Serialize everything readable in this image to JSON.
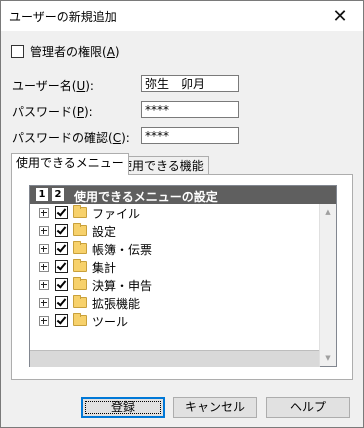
{
  "window": {
    "title": "ユーザーの新規追加",
    "close_glyph": "✕"
  },
  "admin_checkbox": {
    "label": "管理者の権限(",
    "accel": "A",
    "label_end": ")",
    "checked": false
  },
  "fields": {
    "username": {
      "label": "ユーザー名(",
      "accel": "U",
      "label_end": "):",
      "value": "弥生　卯月"
    },
    "password": {
      "label": "パスワード(",
      "accel": "P",
      "label_end": "):",
      "value": "****"
    },
    "password_confirm": {
      "label": "パスワードの確認(",
      "accel": "C",
      "label_end": "):",
      "value": "****"
    }
  },
  "tabs": {
    "menus": "使用できるメニュー",
    "features": "使用できる機能"
  },
  "tree": {
    "levels": [
      "1",
      "2"
    ],
    "header": "使用できるメニューの設定",
    "items": [
      {
        "label": "ファイル",
        "checked": true
      },
      {
        "label": "設定",
        "checked": true
      },
      {
        "label": "帳簿・伝票",
        "checked": true
      },
      {
        "label": "集計",
        "checked": true
      },
      {
        "label": "決算・申告",
        "checked": true
      },
      {
        "label": "拡張機能",
        "checked": true
      },
      {
        "label": "ツール",
        "checked": true
      }
    ]
  },
  "buttons": {
    "register": "登録",
    "cancel": "キャンセル",
    "help": "ヘルプ"
  },
  "icons": {
    "close": "close-icon",
    "folder": "folder-icon",
    "expand": "plus-expander-icon",
    "check": "checkmark-icon"
  }
}
